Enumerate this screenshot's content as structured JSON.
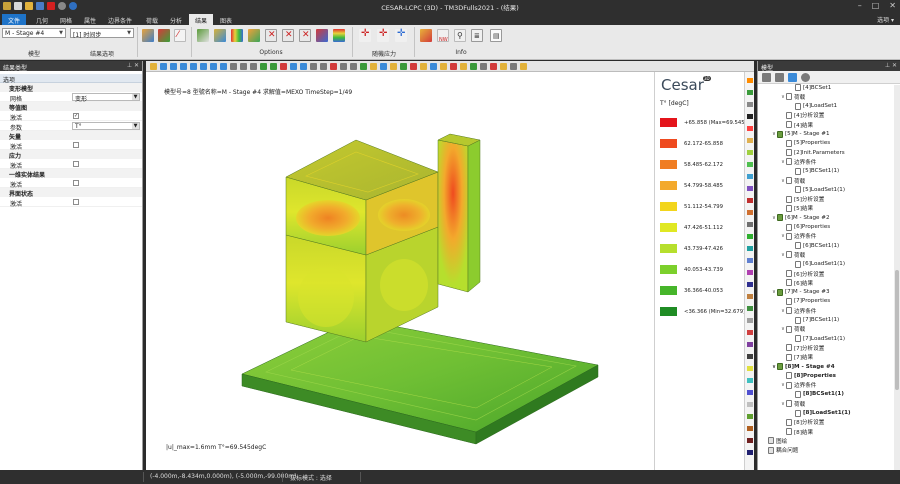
{
  "window": {
    "title": "CESAR-LCPC (3D) - TM3DFulls2021 - (结果)",
    "help_label": "选项 ▾"
  },
  "ribbon_tabs": [
    "文件",
    "几何",
    "网格",
    "属性",
    "边界条件",
    "荷载",
    "分析",
    "结果",
    "图表"
  ],
  "ribbon": {
    "model_select": "M - Stage #4",
    "result_select": "[1] 时间步",
    "group_model": "模型",
    "group_result": "结果选项",
    "group_options": "Options",
    "group_stress": "随機应力",
    "group_info": "Info"
  },
  "left_panel": {
    "title": "结果类型",
    "subtitle": "选项",
    "sections": [
      {
        "heading": "变形模型",
        "rows": [
          {
            "key": "网格",
            "value": "变形",
            "type": "select"
          }
        ]
      },
      {
        "heading": "等值图",
        "rows": [
          {
            "key": "激活",
            "value": "✓",
            "type": "check"
          },
          {
            "key": "参数",
            "value": "T°",
            "type": "select"
          }
        ]
      },
      {
        "heading": "矢量",
        "rows": [
          {
            "key": "激活",
            "value": "",
            "type": "check"
          }
        ]
      },
      {
        "heading": "应力",
        "rows": [
          {
            "key": "激活",
            "value": "",
            "type": "check"
          }
        ]
      },
      {
        "heading": "一维实体结果",
        "rows": [
          {
            "key": "激活",
            "value": "",
            "type": "check"
          }
        ]
      },
      {
        "heading": "界面状态",
        "rows": [
          {
            "key": "激活",
            "value": "",
            "type": "check"
          }
        ]
      }
    ]
  },
  "viewport": {
    "info": "模型号=8   型號名称=M - Stage #4    求解值=MEXO    TimeStep=1/49",
    "bottom_info": "|u|_max=1.6mm  T°=69.545degC",
    "axis_labels": {
      "x": "x",
      "y": "y",
      "z": "z"
    }
  },
  "legend": {
    "logo": "Cesar",
    "badge": "3D",
    "unit": "T° [degC]",
    "entries": [
      {
        "label": "+65.858 (Max=69.545)",
        "color": "#e4141b"
      },
      {
        "label": "62.172-65.858",
        "color": "#ef4a1f"
      },
      {
        "label": "58.485-62.172",
        "color": "#f07d22"
      },
      {
        "label": "54.799-58.485",
        "color": "#f3a92c"
      },
      {
        "label": "51.112-54.799",
        "color": "#f2d51c"
      },
      {
        "label": "47.426-51.112",
        "color": "#e0e823"
      },
      {
        "label": "43.739-47.426",
        "color": "#b6df2d"
      },
      {
        "label": "40.053-43.739",
        "color": "#7cd02c"
      },
      {
        "label": "36.366-40.053",
        "color": "#46b52a"
      },
      {
        "label": "<36.366 (Min=32.679)",
        "color": "#1f8c24"
      }
    ]
  },
  "palette_colors": [
    "#ff8c00",
    "#3b9c3b",
    "#8a8a8a",
    "#222222",
    "#ff4040",
    "#e0b050",
    "#a0d040",
    "#50c050",
    "#40a0d0",
    "#8050c0",
    "#c03030",
    "#d07030",
    "#707070",
    "#30b030",
    "#20a0a0",
    "#6080d0",
    "#b040b0",
    "#303090",
    "#c08040",
    "#409040",
    "#a0a0a0",
    "#d04040",
    "#8040a0",
    "#404040",
    "#e0e040",
    "#40c0c0",
    "#5050d0",
    "#c0c0c0",
    "#60a030",
    "#b06020",
    "#702020",
    "#202070"
  ],
  "right_panel": {
    "title": "模型",
    "tree": [
      {
        "text": "[4]BCSet1",
        "depth": 3,
        "expander": "",
        "icon": "doc",
        "bold": false
      },
      {
        "text": "荷载",
        "depth": 2,
        "expander": "∨",
        "icon": "doc",
        "bold": false
      },
      {
        "text": "[4]LoadSet1",
        "depth": 3,
        "expander": "",
        "icon": "doc",
        "bold": false
      },
      {
        "text": "[4]分析设置",
        "depth": 2,
        "expander": "",
        "icon": "doc",
        "bold": false
      },
      {
        "text": "[4]结果",
        "depth": 2,
        "expander": "",
        "icon": "doc",
        "bold": false
      },
      {
        "text": "[5]M - Stage #1",
        "depth": 1,
        "expander": "∨",
        "icon": "stage",
        "bold": false
      },
      {
        "text": "[5]Properties",
        "depth": 2,
        "expander": "",
        "icon": "doc",
        "bold": false
      },
      {
        "text": "[2]Init.Parameters",
        "depth": 2,
        "expander": "",
        "icon": "doc",
        "bold": false
      },
      {
        "text": "边界条件",
        "depth": 2,
        "expander": "∨",
        "icon": "doc",
        "bold": false
      },
      {
        "text": "[5]BCSet1(1)",
        "depth": 3,
        "expander": "",
        "icon": "doc",
        "bold": false
      },
      {
        "text": "荷载",
        "depth": 2,
        "expander": "∨",
        "icon": "doc",
        "bold": false
      },
      {
        "text": "[5]LoadSet1(1)",
        "depth": 3,
        "expander": "",
        "icon": "doc",
        "bold": false
      },
      {
        "text": "[5]分析设置",
        "depth": 2,
        "expander": "",
        "icon": "doc",
        "bold": false
      },
      {
        "text": "[5]结果",
        "depth": 2,
        "expander": "",
        "icon": "doc",
        "bold": false
      },
      {
        "text": "[6]M - Stage #2",
        "depth": 1,
        "expander": "∨",
        "icon": "stage",
        "bold": false
      },
      {
        "text": "[6]Properties",
        "depth": 2,
        "expander": "",
        "icon": "doc",
        "bold": false
      },
      {
        "text": "边界条件",
        "depth": 2,
        "expander": "∨",
        "icon": "doc",
        "bold": false
      },
      {
        "text": "[6]BCSet1(1)",
        "depth": 3,
        "expander": "",
        "icon": "doc",
        "bold": false
      },
      {
        "text": "荷载",
        "depth": 2,
        "expander": "∨",
        "icon": "doc",
        "bold": false
      },
      {
        "text": "[6]LoadSet1(1)",
        "depth": 3,
        "expander": "",
        "icon": "doc",
        "bold": false
      },
      {
        "text": "[6]分析设置",
        "depth": 2,
        "expander": "",
        "icon": "doc",
        "bold": false
      },
      {
        "text": "[6]结果",
        "depth": 2,
        "expander": "",
        "icon": "doc",
        "bold": false
      },
      {
        "text": "[7]M - Stage #3",
        "depth": 1,
        "expander": "∨",
        "icon": "stage",
        "bold": false
      },
      {
        "text": "[7]Properties",
        "depth": 2,
        "expander": "",
        "icon": "doc",
        "bold": false
      },
      {
        "text": "边界条件",
        "depth": 2,
        "expander": "∨",
        "icon": "doc",
        "bold": false
      },
      {
        "text": "[7]BCSet1(1)",
        "depth": 3,
        "expander": "",
        "icon": "doc",
        "bold": false
      },
      {
        "text": "荷载",
        "depth": 2,
        "expander": "∨",
        "icon": "doc",
        "bold": false
      },
      {
        "text": "[7]LoadSet1(1)",
        "depth": 3,
        "expander": "",
        "icon": "doc",
        "bold": false
      },
      {
        "text": "[7]分析设置",
        "depth": 2,
        "expander": "",
        "icon": "doc",
        "bold": false
      },
      {
        "text": "[7]结果",
        "depth": 2,
        "expander": "",
        "icon": "doc",
        "bold": false
      },
      {
        "text": "[8]M - Stage #4",
        "depth": 1,
        "expander": "∨",
        "icon": "stage",
        "bold": true
      },
      {
        "text": "[8]Properties",
        "depth": 2,
        "expander": "",
        "icon": "doc",
        "bold": true
      },
      {
        "text": "边界条件",
        "depth": 2,
        "expander": "∨",
        "icon": "doc",
        "bold": false
      },
      {
        "text": "[8]BCSet1(1)",
        "depth": 3,
        "expander": "",
        "icon": "doc",
        "bold": true
      },
      {
        "text": "荷载",
        "depth": 2,
        "expander": "∨",
        "icon": "doc",
        "bold": false
      },
      {
        "text": "[8]LoadSet1(1)",
        "depth": 3,
        "expander": "",
        "icon": "doc",
        "bold": true
      },
      {
        "text": "[8]分析设置",
        "depth": 2,
        "expander": "",
        "icon": "doc",
        "bold": false
      },
      {
        "text": "[8]结果",
        "depth": 2,
        "expander": "",
        "icon": "doc",
        "bold": false
      },
      {
        "text": "图绘",
        "depth": 0,
        "expander": "",
        "icon": "folder",
        "bold": false
      },
      {
        "text": "耦合问题",
        "depth": 0,
        "expander": "",
        "icon": "folder",
        "bold": false
      }
    ]
  },
  "status_bar": {
    "coords": "(-4.000m,-8.434m,0.000m), (-5.000m,-99.000m)",
    "mode": "拔标模式 : 选择"
  }
}
